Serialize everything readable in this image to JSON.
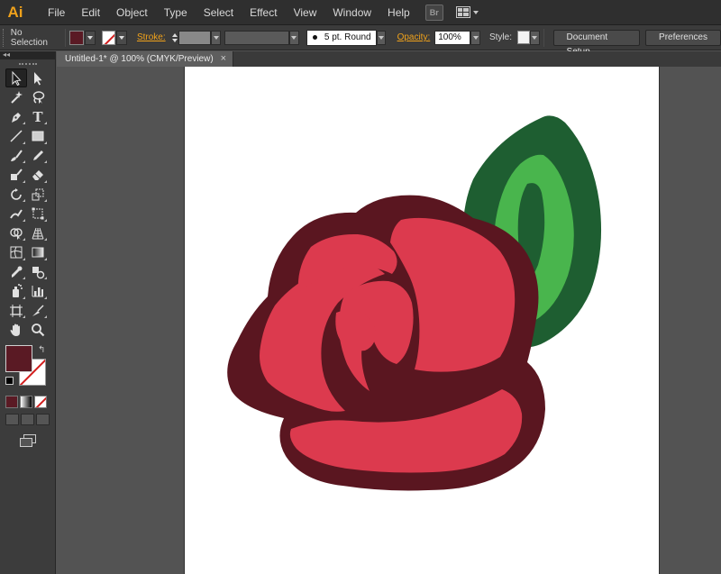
{
  "app": {
    "logo_text": "Ai",
    "brand_color": "#f0a21b"
  },
  "menu": {
    "items": [
      "File",
      "Edit",
      "Object",
      "Type",
      "Select",
      "Effect",
      "View",
      "Window",
      "Help"
    ],
    "bridge_label": "Br"
  },
  "control_bar": {
    "selection_status": "No Selection",
    "fill_color": "#5a1a24",
    "stroke_label": "Stroke:",
    "brush_label": "5 pt. Round",
    "opacity_label": "Opacity:",
    "opacity_value": "100%",
    "style_label": "Style:",
    "document_setup_label": "Document Setup",
    "preferences_label": "Preferences"
  },
  "document": {
    "tab_title": "Untitled-1* @ 100% (CMYK/Preview)",
    "close_glyph": "×"
  },
  "tools": {
    "collapse_glyph": "◂◂",
    "swap_glyph": "↰",
    "type_tool_glyph": "T",
    "fill_color": "#5a1a24"
  },
  "artwork": {
    "rose_outline_color": "#5a1620",
    "rose_petal_color": "#dc3a4e",
    "leaf_outline_color": "#1e5e31",
    "leaf_fill_color": "#49b54d"
  }
}
